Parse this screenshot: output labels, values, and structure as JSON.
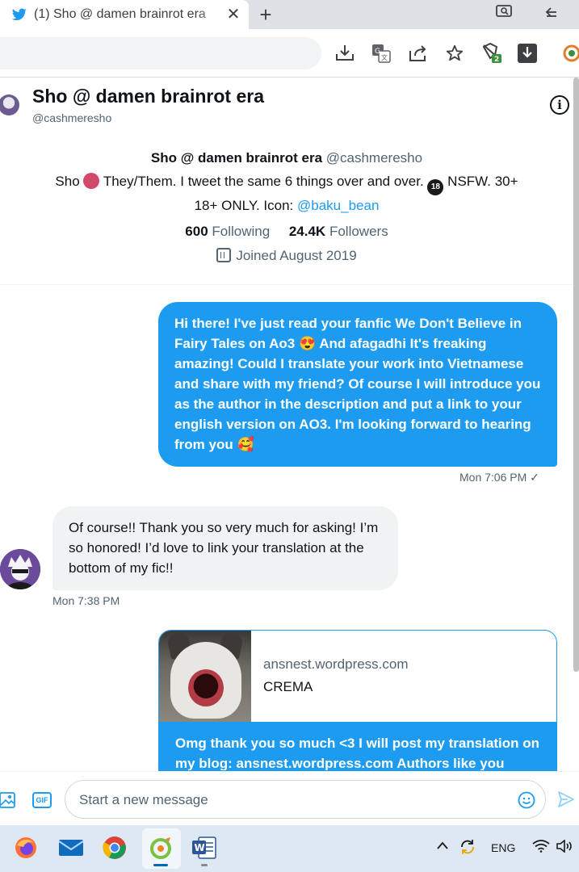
{
  "browser": {
    "tab_title": "(1) Sho @ damen brainrot era",
    "new_tab": "+",
    "close": "✕"
  },
  "dm": {
    "name": "Sho @ damen brainrot era",
    "handle": "@cashmeresho"
  },
  "profile": {
    "name": "Sho @ damen brainrot era",
    "handle": "@cashmeresho",
    "bio_part1": "Sho",
    "bio_part2": "They/Them. I tweet the same 6 things over and over.",
    "bio_part3": "NSFW. 30+",
    "bio_line2": "18+ ONLY. Icon:",
    "bio_mention": "@baku_bean",
    "following_count": "600",
    "following_label": "Following",
    "followers_count": "24.4K",
    "followers_label": "Followers",
    "joined": "Joined August 2019"
  },
  "messages": [
    {
      "direction": "sent",
      "text": "Hi there! I've just read your fanfic We Don't Believe in Fairy Tales on Ao3 😍 And afagadhi It's freaking amazing! Could I translate your work into Vietnamese and share with my friend? Of course I will introduce you as the author in the description and put a link to your english version on AO3. I'm looking forward to hearing from you 🥰",
      "time": "Mon 7:06 PM ✓"
    },
    {
      "direction": "received",
      "text": "Of course!! Thank you so very much for asking! I’m so honored! I’d love to link your translation at the bottom of my fic!!",
      "time": "Mon 7:38 PM"
    },
    {
      "direction": "sent",
      "card_domain": "ansnest.wordpress.com",
      "card_title": "CREMA",
      "text": "Omg thank you so much <3 I will post my translation on my blog: ansnest.wordpress.com Authors like you"
    }
  ],
  "composer": {
    "gif_label": "GIF",
    "placeholder": "Start a new message"
  },
  "taskbar": {
    "language": "ENG",
    "apps": [
      "firefox-icon",
      "mail-icon",
      "chrome-icon",
      "app-icon",
      "word-icon"
    ]
  },
  "colors": {
    "twitter_blue": "#1d9bf0",
    "received_bubble": "#eff3f4",
    "secondary_text": "#536471"
  }
}
